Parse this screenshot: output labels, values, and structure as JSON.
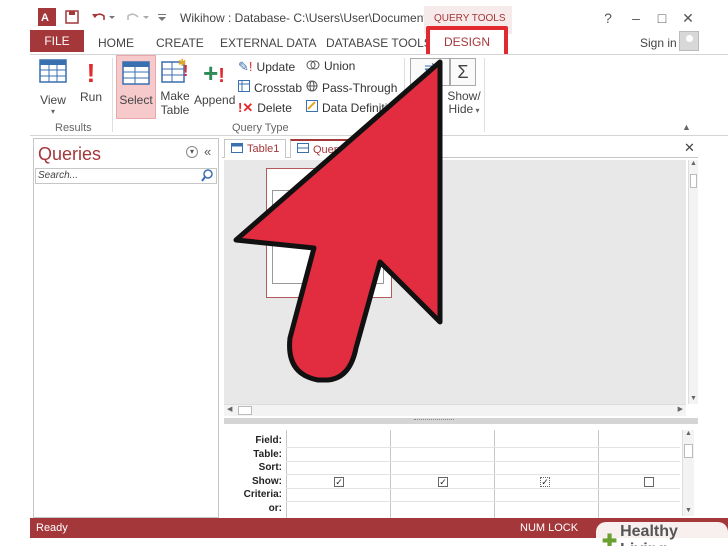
{
  "window": {
    "title": "Wikihow : Database- C:\\Users\\User\\Documents\\...",
    "context_tab_group": "QUERY TOOLS",
    "help": "?",
    "minimize": "–",
    "maximize": "□",
    "close": "✕"
  },
  "ribbon_tabs": {
    "file": "FILE",
    "home": "HOME",
    "create": "CREATE",
    "external_data": "EXTERNAL DATA",
    "database_tools": "DATABASE TOOLS",
    "design": "DESIGN",
    "sign_in": "Sign in"
  },
  "ribbon": {
    "view": "View",
    "run": "Run",
    "results_group": "Results",
    "select": "Select",
    "make_table_1": "Make",
    "make_table_2": "Table",
    "append": "Append",
    "update": "Update",
    "crosstab": "Crosstab",
    "delete": "Delete",
    "union": "Union",
    "pass_through": "Pass-Through",
    "data_definition": "Data Definitio",
    "query_type_group": "Query Type",
    "show_hide_1": "Show/",
    "show_hide_2": "Hide"
  },
  "nav_pane": {
    "title": "Queries",
    "search_placeholder": "Search..."
  },
  "doc_tabs": {
    "tab1": "Table1",
    "tab2": "Query"
  },
  "grid": {
    "labels": [
      "Field:",
      "Table:",
      "Sort:",
      "Show:",
      "Criteria:",
      "or:"
    ],
    "show_checked": [
      true,
      true,
      true,
      false
    ]
  },
  "status": {
    "ready": "Ready",
    "num_lock": "NUM LOCK"
  },
  "watermark": "Healthy Living",
  "colors": {
    "access_accent": "#a4373a",
    "highlight_box": "#e02a2f",
    "arrow_fill": "#e12d3f"
  }
}
